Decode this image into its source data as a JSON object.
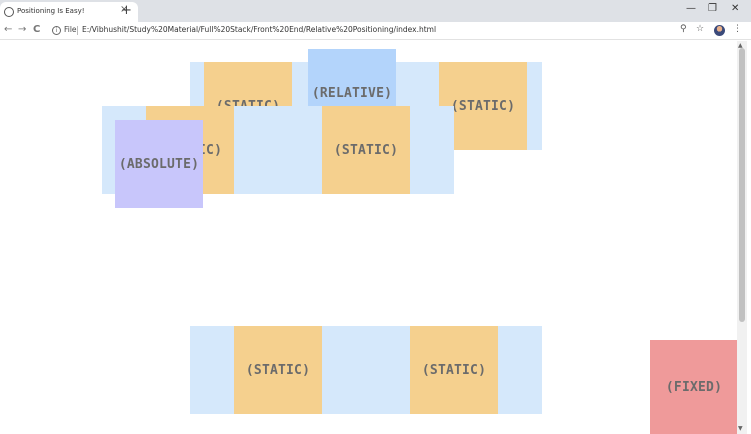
{
  "browser": {
    "tab_title": "Positioning Is Easy!",
    "tab_close": "×",
    "new_tab": "+",
    "minimize": "—",
    "maximize": "❐",
    "close": "✕",
    "back": "←",
    "forward": "→",
    "reload": "C",
    "info": "i",
    "file_label": "File",
    "url": "E:/Vibhushit/Study%20Material/Full%20Stack/Front%20End/Relative%20Positioning/index.html",
    "zoom_icon": "⚲",
    "star_icon": "☆",
    "menu_icon": "⋮"
  },
  "page": {
    "boxes": {
      "static_hidden_top": "(STATIC)",
      "relative": "(RELATIVE)",
      "static_top_right": "(STATIC)",
      "static_mid_left": "(STATIC)",
      "static_mid_right": "(STATIC)",
      "absolute": "(ABSOLUTE)",
      "static_bottom_left": "(STATIC)",
      "static_bottom_right": "(STATIC)",
      "fixed": "(FIXED)"
    }
  },
  "colors": {
    "parent": "#d5e8fb",
    "static": "#f5d08e",
    "relative": "#b3d4fb",
    "absolute": "#c8c6fb",
    "fixed": "#ef9a9a"
  }
}
